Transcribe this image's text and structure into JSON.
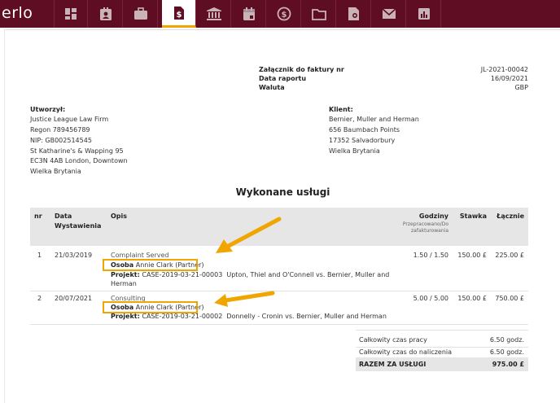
{
  "app": {
    "logo": "erlo",
    "accent": "#5e0d22",
    "highlight": "#f0a500"
  },
  "nav": [
    {
      "name": "dashboard-icon"
    },
    {
      "name": "contacts-icon"
    },
    {
      "name": "briefcase-icon"
    },
    {
      "name": "invoice-dollar-icon",
      "active": true
    },
    {
      "name": "bank-icon"
    },
    {
      "name": "calendar-icon"
    },
    {
      "name": "time-dollar-icon"
    },
    {
      "name": "folder-icon"
    },
    {
      "name": "certificate-document-icon"
    },
    {
      "name": "mail-icon"
    },
    {
      "name": "report-chart-icon"
    }
  ],
  "invoice": {
    "meta": {
      "attachment_label": "Załącznik do faktury nr",
      "attachment_value": "JL-2021-00042",
      "report_date_label": "Data raportu",
      "report_date_value": "16/09/2021",
      "currency_label": "Waluta",
      "currency_value": "GBP"
    },
    "creator": {
      "heading": "Utworzył:",
      "lines": [
        "Justice League Law Firm",
        "Regon 789456789",
        "NIP: GB002514545",
        "St Katharine's & Wapping 95",
        "EC3N 4AB London, Downtown",
        "Wielka Brytania"
      ]
    },
    "client": {
      "heading": "Klient:",
      "lines": [
        "Bernier, Muller and Herman",
        "656 Baumbach Points",
        "17352 Salvadorbury",
        "Wielka Brytania"
      ]
    },
    "section_title": "Wykonane usługi",
    "table": {
      "headers": {
        "nr": "nr",
        "date_line1": "Data",
        "date_line2": "Wystawienia",
        "desc": "Opis",
        "hours": "Godziny",
        "hours_sub1": "Przepracowano/Do",
        "hours_sub2": "zafakturowania",
        "rate": "Stawka",
        "total": "Łącznie"
      },
      "person_label": "Osoba",
      "project_label": "Projekt:",
      "rows": [
        {
          "nr": "1",
          "date": "21/03/2019",
          "activity": "Complaint Served",
          "person": "Annie Clark (Partner)",
          "project_code": "CASE-2019-03-21-00003",
          "project_line1": "Upton, Thiel and O'Connell vs. Bernier, Muller and",
          "project_line2": "Herman",
          "hours": "1.50  /  1.50",
          "rate": "150.00 £",
          "total": "225.00 £"
        },
        {
          "nr": "2",
          "date": "20/07/2021",
          "activity": "Consulting",
          "person": "Annie Clark (Partner)",
          "project_code": "CASE-2019-03-21-00002",
          "project_line1": "Donnelly - Cronin vs. Bernier, Muller and Herman",
          "hours": "5.00  /  5.00",
          "rate": "150.00 £",
          "total": "750.00 £"
        }
      ]
    },
    "summary": {
      "work_time_label": "Całkowity czas pracy",
      "work_time_value": "6.50 godz.",
      "billable_label": "Całkowity czas do naliczenia",
      "billable_value": "6.50 godz.",
      "total_label": "RAZEM ZA USŁUGI",
      "total_value": "975.00 £"
    }
  }
}
